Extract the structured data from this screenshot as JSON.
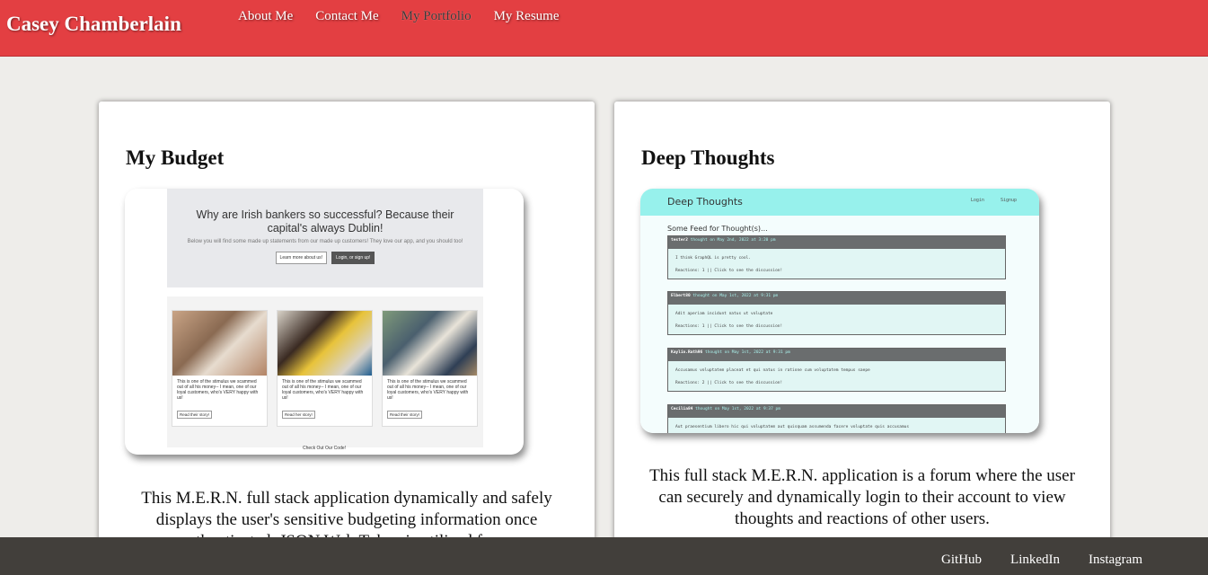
{
  "header": {
    "brand": "Casey Chamberlain",
    "nav": [
      "About Me",
      "Contact Me",
      "My Portfolio",
      "My Resume"
    ],
    "active_nav": "My Portfolio",
    "bg_color": "#e33f42"
  },
  "projects": [
    {
      "title": "My Budget",
      "description": "This M.E.R.N. full stack application dynamically and safely displays the user's sensitive budgeting information once authenticated. JSON Web Token is utilized for ...",
      "screenshot": {
        "hero_text": "Why are Irish bankers so successful? Because their capital's always Dublin!",
        "hero_sub": "Below you will find some made up statements from our made up customers! They love our app, and you should too!",
        "buttons": [
          "Learn more about us!",
          "Login, or sign up!"
        ],
        "cards": [
          {
            "text": "This is one of the stimulus we scammed out of all his money-- I mean, one of our loyal customers, who's VERY happy with us!",
            "button": "Read their story!"
          },
          {
            "text": "This is one of the stimulus we scammed out of all his money-- I mean, one of our loyal customers, who's VERY happy with us!",
            "button": "Read her story!"
          },
          {
            "text": "This is one of the stimulus we scammed out of all his money-- I mean, one of our loyal customers, who's VERY happy with us!",
            "button": "Read their story!"
          }
        ],
        "footer": "Check Out Our Code!"
      }
    },
    {
      "title": "Deep Thoughts",
      "description": "This full stack M.E.R.N. application is a forum where the user can securely and dynamically login to their account to view thoughts and reactions of other users.",
      "screenshot": {
        "app_title": "Deep Thoughts",
        "links": [
          "Login",
          "Signup"
        ],
        "feed_title": "Some Feed for Thought(s)...",
        "posts": [
          {
            "user": "tester2",
            "meta": "thought on May 2nd, 2022 at 3:20 pm",
            "body": "I think GraphQL is pretty cool.",
            "reactions": "Reactions: 1 || Click to see the discussion!"
          },
          {
            "user": "Elbert80",
            "meta": "thought on May 1st, 2022 at 9:31 pm",
            "body": "Adit aperiam incidunt natus ut voluptate",
            "reactions": "Reactions: 1 || Click to see the discussion!"
          },
          {
            "user": "Kaylin.Rath96",
            "meta": "thought on May 1st, 2022 at 9:31 pm",
            "body": "Accusamus voluptatem placeat et qui natus in ratione cum voluptatem tempus saepe",
            "reactions": "Reactions: 2 || Click to see the discussion!"
          },
          {
            "user": "Cecilia84",
            "meta": "thought on May 1st, 2022 at 9:37 pm",
            "body": "Aut praesentium libero hic qui voluptatem aut quisquam assumenda facere voluptate quis accusamus",
            "reactions": ""
          }
        ]
      }
    }
  ],
  "footer": {
    "links": [
      "GitHub",
      "LinkedIn",
      "Instagram"
    ],
    "bg_color": "#423f3b"
  }
}
